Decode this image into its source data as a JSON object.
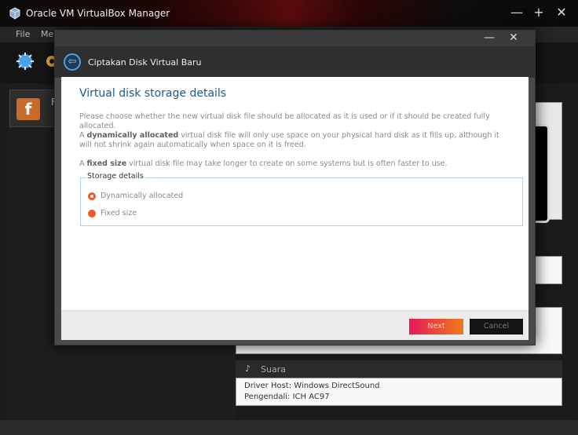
{
  "app": {
    "window_title": "Oracle VM VirtualBox Manager",
    "controls": {
      "minimize": "—",
      "maximize": "+",
      "close": "✕"
    }
  },
  "menubar": {
    "file": "File",
    "machine_partial": "Me"
  },
  "vm_list": {
    "item": {
      "name_partial": "F",
      "state_partial": "",
      "os_glyph": "f"
    }
  },
  "details": {
    "audio_header": "Suara",
    "audio_lines": [
      "Driver Host: Windows DirectSound",
      "Pengendali: ICH AC97"
    ]
  },
  "dialog": {
    "window_controls": {
      "minimize": "—",
      "close": "✕"
    },
    "wizard_title": "Ciptakan Disk Virtual Baru",
    "back_glyph": "⇦",
    "heading": "Virtual disk storage details",
    "para1": "Please choose whether the new virtual disk file should be allocated as it is used or if it should be created fully allocated.",
    "para2": {
      "prefix": "A ",
      "bold": "dynamically allocated",
      "rest": " virtual disk file will only use space on your physical hard disk as it fills up, although it will not shrink again automatically when space on it is freed."
    },
    "para3": {
      "prefix": "A ",
      "bold": "fixed size",
      "rest": " virtual disk file may take longer to create on some systems but is often faster to use."
    },
    "storage_group": {
      "legend": "Storage details",
      "options": [
        {
          "label": "Dynamically allocated",
          "checked": true
        },
        {
          "label": "Fixed size",
          "checked": false
        }
      ]
    },
    "buttons": {
      "next": "Next",
      "cancel": "Cancel"
    }
  },
  "colors": {
    "accent_orange": "#f05a23",
    "heading_blue": "#1d5a8a",
    "group_border": "#a9d3f0"
  }
}
